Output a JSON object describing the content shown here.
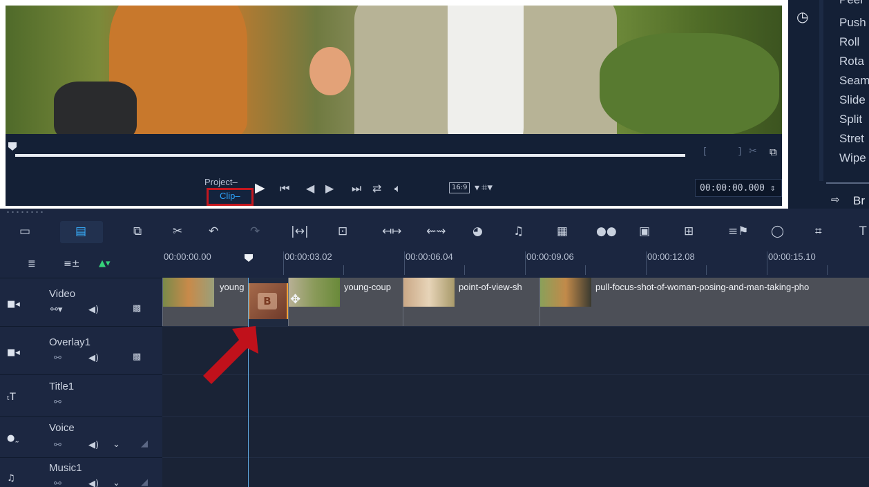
{
  "right_panel": {
    "items": [
      "Peel",
      "Push",
      "Roll",
      "Rota",
      "Seam",
      "Slide",
      "Split",
      "Stret",
      "Wipe"
    ],
    "browse_label": "Br"
  },
  "transport": {
    "project_label": "Project",
    "clip_label": "Clip",
    "aspect_label": "16:9",
    "timecode": "00:00:00.000"
  },
  "ruler": {
    "ticks": [
      "00:00:00.00",
      "00:00:03.02",
      "00:00:06.04",
      "00:00:09.06",
      "00:00:12.08",
      "00:00:15.10"
    ]
  },
  "tracks": [
    {
      "name": "Video"
    },
    {
      "name": "Overlay1"
    },
    {
      "name": "Title1"
    },
    {
      "name": "Voice"
    },
    {
      "name": "Music1"
    }
  ],
  "clips": [
    {
      "name": "young"
    },
    {
      "name": "young-coup"
    },
    {
      "name": "point-of-view-sh"
    },
    {
      "name": "pull-focus-shot-of-woman-posing-and-man-taking-pho"
    }
  ],
  "colors": {
    "accent_blue": "#2ea7ff",
    "highlight_red": "#c4171f",
    "transition_orange": "#f2a33a",
    "panel_bg": "#142036"
  }
}
